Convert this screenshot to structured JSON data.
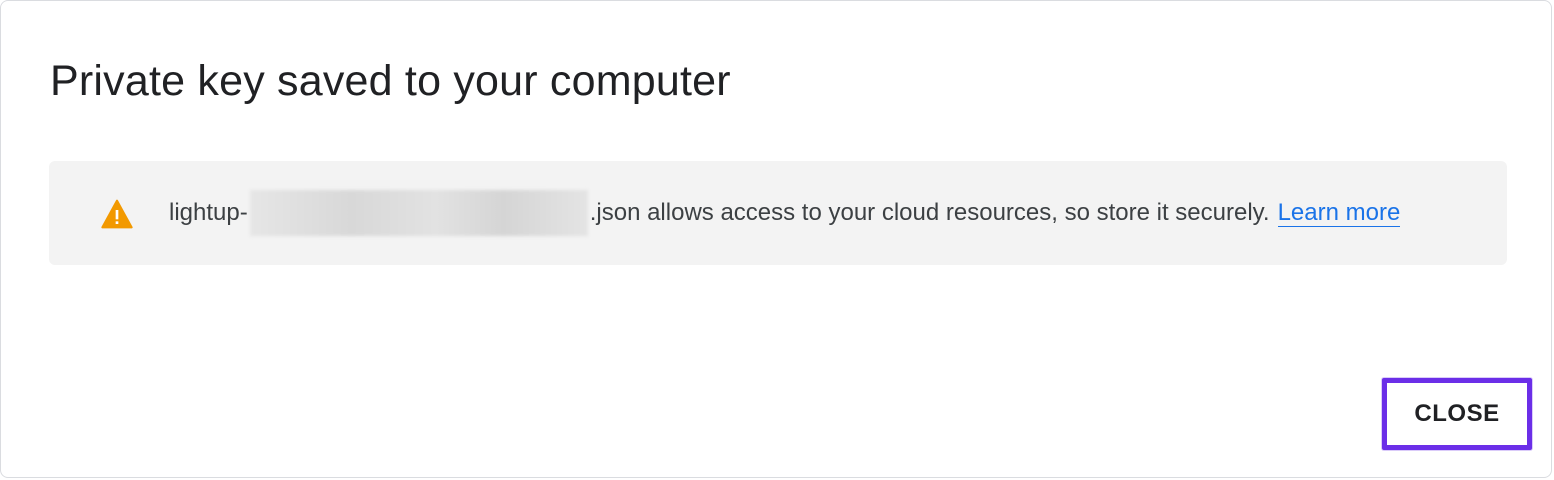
{
  "dialog": {
    "title": "Private key saved to your computer",
    "notice": {
      "icon": "warning-icon",
      "icon_color": "#f29900",
      "filename_prefix": "lightup-",
      "message": ".json allows access to your cloud resources, so store it securely.",
      "link_label": "Learn more",
      "link_color": "#1a73e8"
    },
    "close_label": "CLOSE",
    "close_highlight_color": "#6b2ee8"
  }
}
